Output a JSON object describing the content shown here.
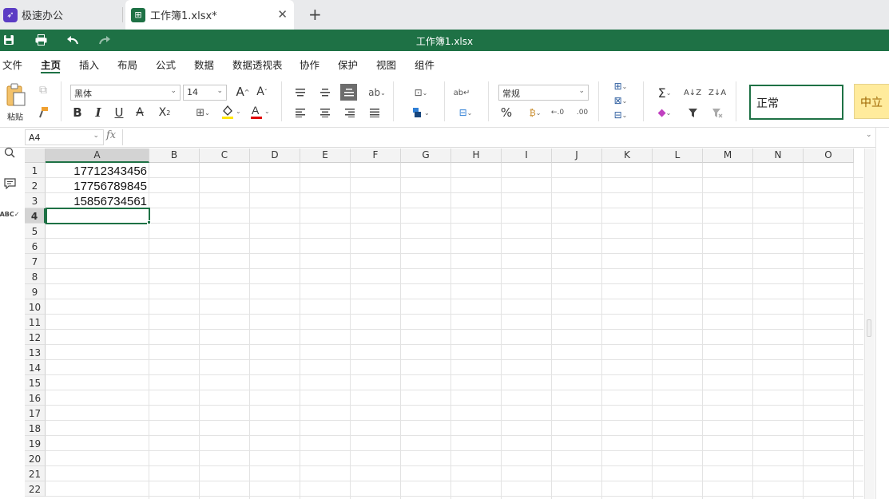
{
  "tabs": [
    {
      "label": "极速办公"
    },
    {
      "label": "工作簿1.xlsx*"
    }
  ],
  "titlebar": {
    "doc_title": "工作簿1.xlsx"
  },
  "menu": [
    "文件",
    "主页",
    "插入",
    "布局",
    "公式",
    "数据",
    "数据透视表",
    "协作",
    "保护",
    "视图",
    "组件"
  ],
  "menu_active": "主页",
  "ribbon": {
    "paste_label": "粘贴",
    "font_name": "黑体",
    "font_size": "14",
    "number_format": "常规",
    "style_normal": "正常",
    "style_neutral": "中立",
    "accent_color": "#1e7145"
  },
  "formula_bar": {
    "name_box": "A4",
    "fx_label": "fx",
    "formula": ""
  },
  "columns": [
    "A",
    "B",
    "C",
    "D",
    "E",
    "F",
    "G",
    "H",
    "I",
    "J",
    "K",
    "L",
    "M",
    "N",
    "O"
  ],
  "rows": [
    "1",
    "2",
    "3",
    "4",
    "5",
    "6",
    "7",
    "8",
    "9",
    "10",
    "11",
    "12",
    "13",
    "14",
    "15",
    "16",
    "17",
    "18",
    "19",
    "20",
    "21",
    "22"
  ],
  "cells": {
    "A1": "17712343456",
    "A2": "17756789845",
    "A3": "15856734561"
  },
  "selected_cell": "A4"
}
